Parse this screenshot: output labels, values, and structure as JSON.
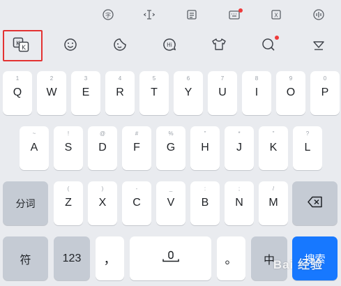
{
  "toolbar_top": [
    {
      "icon": "translate-char-icon",
      "label": "字"
    },
    {
      "icon": "cursor-move-icon",
      "label": ""
    },
    {
      "icon": "clipboard-list-icon",
      "label": ""
    },
    {
      "icon": "keyboard-icon",
      "label": ""
    },
    {
      "icon": "text-editor-icon",
      "label": "X"
    },
    {
      "icon": "voice-mic-icon",
      "label": ""
    }
  ],
  "toolbar_main": [
    {
      "icon": "kk-keyboard-icon",
      "label": "K"
    },
    {
      "icon": "emoji-face-icon",
      "label": ""
    },
    {
      "icon": "sticker-icon",
      "label": ""
    },
    {
      "icon": "hi-bubble-icon",
      "label": "Hi"
    },
    {
      "icon": "clothing-skin-icon",
      "label": ""
    },
    {
      "icon": "search-icon",
      "label": ""
    },
    {
      "icon": "collapse-keyboard-icon",
      "label": ""
    }
  ],
  "keys_row1": [
    {
      "hint": "1",
      "key": "Q"
    },
    {
      "hint": "2",
      "key": "W"
    },
    {
      "hint": "3",
      "key": "E"
    },
    {
      "hint": "4",
      "key": "R"
    },
    {
      "hint": "5",
      "key": "T"
    },
    {
      "hint": "6",
      "key": "Y"
    },
    {
      "hint": "7",
      "key": "U"
    },
    {
      "hint": "8",
      "key": "I"
    },
    {
      "hint": "9",
      "key": "O"
    },
    {
      "hint": "0",
      "key": "P"
    }
  ],
  "keys_row2": [
    {
      "hint": "~",
      "key": "A"
    },
    {
      "hint": "!",
      "key": "S"
    },
    {
      "hint": "@",
      "key": "D"
    },
    {
      "hint": "#",
      "key": "F"
    },
    {
      "hint": "%",
      "key": "G"
    },
    {
      "hint": "\"",
      "key": "H"
    },
    {
      "hint": "*",
      "key": "J"
    },
    {
      "hint": "\"",
      "key": "K"
    },
    {
      "hint": "?",
      "key": "L"
    }
  ],
  "keys_row3": [
    {
      "hint": "(",
      "key": "Z"
    },
    {
      "hint": ")",
      "key": "X"
    },
    {
      "hint": "-",
      "key": "C"
    },
    {
      "hint": "_",
      "key": "V"
    },
    {
      "hint": ":",
      "key": "B"
    },
    {
      "hint": ";",
      "key": "N"
    },
    {
      "hint": "/",
      "key": "M"
    }
  ],
  "segment_label": "分词",
  "backspace_icon": "backspace-icon",
  "bottom": {
    "symbols_label": "符",
    "numbers_label": "123",
    "comma_label": "，",
    "period_label": "。",
    "space_icon": "mic-icon",
    "lang_label": "中",
    "search_label": "搜索"
  },
  "watermark": "Bai 经验",
  "colors": {
    "accent": "#1778ff",
    "highlight": "#e33232",
    "background": "#e9ebef",
    "gray_key": "#c5cbd4"
  }
}
